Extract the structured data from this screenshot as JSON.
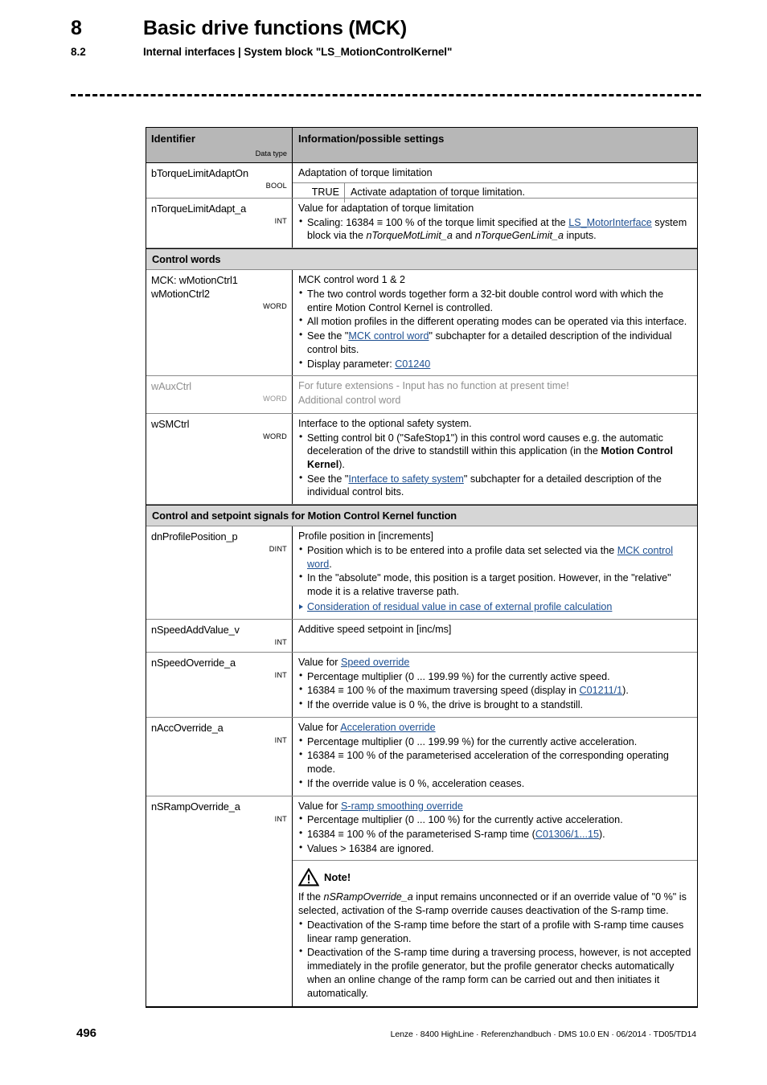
{
  "header": {
    "chapter_number": "8",
    "chapter_title": "Basic drive functions (MCK)",
    "section_number": "8.2",
    "section_title": "Internal interfaces | System block \"LS_MotionControlKernel\""
  },
  "table": {
    "columns": {
      "identifier": "Identifier",
      "data_type": "Data type",
      "information": "Information/possible settings"
    },
    "rows": [
      {
        "id": "row-btorquelimitadapton",
        "identifier": "bTorqueLimitAdaptOn",
        "data_type": "BOOL",
        "lead": "Adaptation of torque limitation",
        "value_row": {
          "value": "TRUE",
          "description": "Activate adaptation of torque limitation."
        }
      },
      {
        "id": "row-ntorquelimitadapt",
        "identifier": "nTorqueLimitAdapt_a",
        "data_type": "INT",
        "lead": "Value for adaptation of torque limitation",
        "bullets": [
          "Scaling: 16384 ≡ 100 % of the torque limit specified at the LS_MotorInterface system block via the nTorqueMotLimit_a and nTorqueGenLimit_a inputs."
        ],
        "link": "LS_MotorInterface"
      }
    ],
    "section_control_words": "Control words",
    "section_control_setpoint": "Control and setpoint signals for Motion Control Kernel function",
    "control_word_rows": [
      {
        "id": "row-wmotionctrl",
        "identifier_line1": "MCK: wMotionCtrl1",
        "identifier_line2": "wMotionCtrl2",
        "data_type": "WORD",
        "lead": "MCK control word 1 & 2",
        "bullets": [
          "The two control words together form a 32-bit double control word with which the entire Motion Control Kernel is controlled.",
          "All motion profiles in the different operating modes can be operated via this interface.",
          "See the \"MCK control word\" subchapter for a detailed description of the individual control bits.",
          "Display parameter: C01240"
        ],
        "links": [
          "MCK control word",
          "C01240"
        ]
      },
      {
        "id": "row-wauxctrl",
        "identifier": "wAuxCtrl",
        "data_type": "WORD",
        "greyed": true,
        "lead": "For future extensions - Input has no function at present time!",
        "lead2": "Additional control word"
      },
      {
        "id": "row-wsmctrl",
        "identifier": "wSMCtrl",
        "data_type": "WORD",
        "lead": "Interface to the optional safety system.",
        "bullets": [
          "Setting control bit 0 (\"SafeStop1\") in this control word causes e.g. the automatic deceleration of the drive to standstill within this application (in the Motion Control Kernel).",
          "See the \"Interface to safety system\" subchapter for a detailed description of the individual control bits."
        ],
        "links": [
          "Interface to safety system"
        ],
        "bold_phrase": "Motion Control Kernel"
      }
    ],
    "setpoint_rows": [
      {
        "id": "row-dnprofileposition",
        "identifier": "dnProfilePosition_p",
        "data_type": "DINT",
        "lead": "Profile position in [increments]",
        "bullets": [
          "Position which is to be entered into a profile data set selected via the MCK control word.",
          "In the \"absolute\" mode, this position is a target position. However, in the \"relative\" mode it is a relative traverse path."
        ],
        "links": [
          "MCK control word"
        ],
        "arrow_link": "Consideration of residual value in case of external profile calculation"
      },
      {
        "id": "row-nspeedaddvalue",
        "identifier": "nSpeedAddValue_v",
        "data_type": "INT",
        "lead": "Additive speed setpoint in [inc/ms]"
      },
      {
        "id": "row-nspeedoverride",
        "identifier": "nSpeedOverride_a",
        "data_type": "INT",
        "lead_prefix": "Value for ",
        "lead_link": "Speed override",
        "bullets": [
          "Percentage multiplier (0 ... 199.99 %) for the currently active speed.",
          "16384 ≡ 100 % of the maximum traversing speed (display in C01211/1).",
          "If the override value is 0 %, the drive is brought to a standstill."
        ],
        "links": [
          "C01211/1"
        ]
      },
      {
        "id": "row-naccoverride",
        "identifier": "nAccOverride_a",
        "data_type": "INT",
        "lead_prefix": "Value for ",
        "lead_link": "Acceleration override",
        "bullets": [
          "Percentage multiplier (0 ... 199.99 %) for the currently active acceleration.",
          "16384 ≡ 100 % of the parameterised acceleration of the corresponding operating mode.",
          "If the override value is 0 %, acceleration ceases."
        ]
      },
      {
        "id": "row-nsrampoverride",
        "identifier": "nSRampOverride_a",
        "data_type": "INT",
        "lead_prefix": "Value for ",
        "lead_link": "S-ramp smoothing override",
        "bullets": [
          "Percentage multiplier (0 ... 100 %) for the currently active acceleration.",
          "16384 ≡ 100 % of the parameterised S-ramp time (C01306/1...15).",
          "Values > 16384 are ignored."
        ],
        "links": [
          "C01306/1...15"
        ],
        "note": {
          "title": "Note!",
          "icon": "warning-triangle-icon",
          "paragraph": "If the nSRampOverride_a input remains unconnected or if an override value of \"0 %\" is selected, activation of the S-ramp override causes deactivation of the S-ramp time.",
          "italic_phrase": "nSRampOverride_a",
          "bullets": [
            "Deactivation of the S-ramp time before the start of a profile with S-ramp time causes linear ramp generation.",
            "Deactivation of the S-ramp time during a traversing process, however, is not accepted immediately in the profile generator, but the profile generator checks automatically when an online change of the ramp form can be carried out and then initiates it automatically."
          ]
        }
      }
    ]
  },
  "footer": {
    "page_number": "496",
    "reference": "Lenze · 8400 HighLine · Referenzhandbuch · DMS 10.0 EN · 06/2014 · TD05/TD14"
  },
  "colors": {
    "table_header_bg": "#b7b7b7",
    "section_band_bg": "#d6d6d6",
    "link": "#1d4f91",
    "greyed_text": "#8f8f8f"
  }
}
